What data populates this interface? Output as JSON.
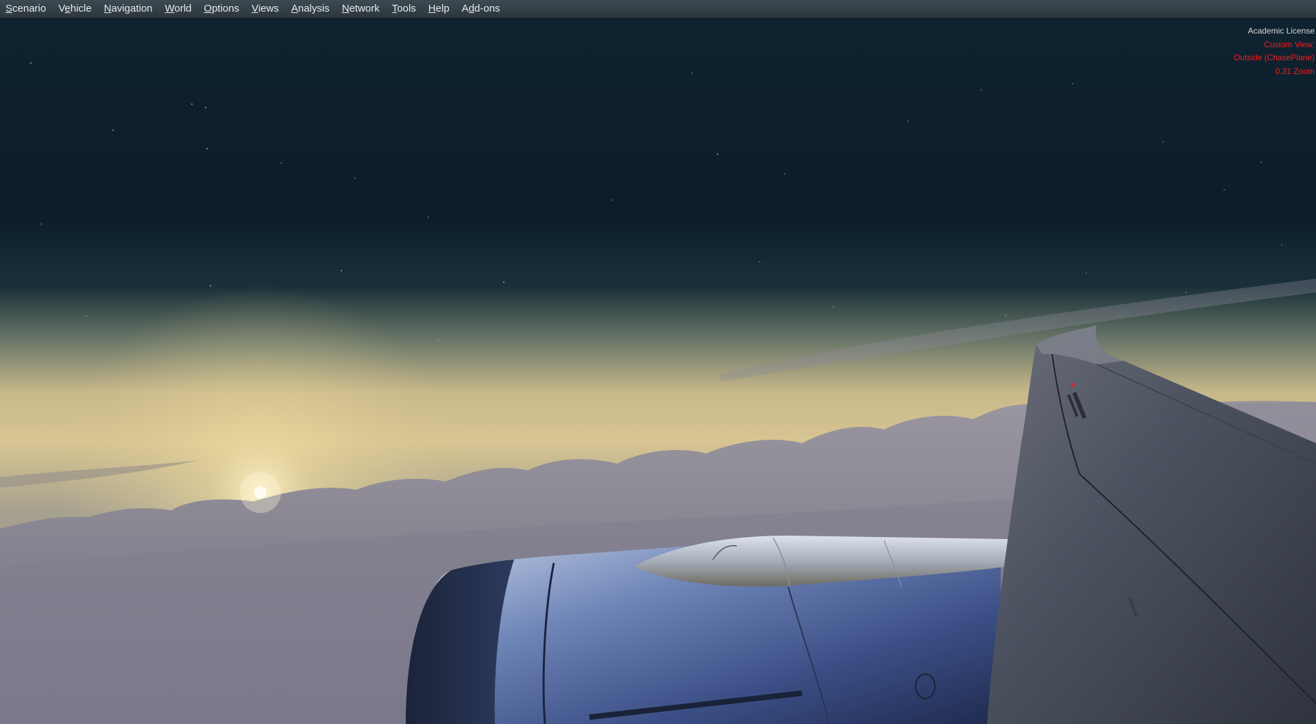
{
  "menu": {
    "items": [
      {
        "pre": "",
        "acc": "S",
        "post": "cenario"
      },
      {
        "pre": "V",
        "acc": "e",
        "post": "hicle"
      },
      {
        "pre": "",
        "acc": "N",
        "post": "avigation"
      },
      {
        "pre": "",
        "acc": "W",
        "post": "orld"
      },
      {
        "pre": "",
        "acc": "O",
        "post": "ptions"
      },
      {
        "pre": "",
        "acc": "V",
        "post": "iews"
      },
      {
        "pre": "",
        "acc": "A",
        "post": "nalysis"
      },
      {
        "pre": "",
        "acc": "N",
        "post": "etwork"
      },
      {
        "pre": "",
        "acc": "T",
        "post": "ools"
      },
      {
        "pre": "",
        "acc": "H",
        "post": "elp"
      },
      {
        "pre": "A",
        "acc": "d",
        "post": "d-ons"
      }
    ]
  },
  "overlay": {
    "license": "Academic License",
    "view_label": "Custom View:",
    "view_name": "Outside (ChasePlane)",
    "zoom": "0.31 Zoom"
  },
  "colors": {
    "sky_top": "#0d1f2a",
    "horizon_glow": "#d9c48e",
    "cloud": "#8c8a98",
    "overlay_red": "#ff1a1a"
  }
}
